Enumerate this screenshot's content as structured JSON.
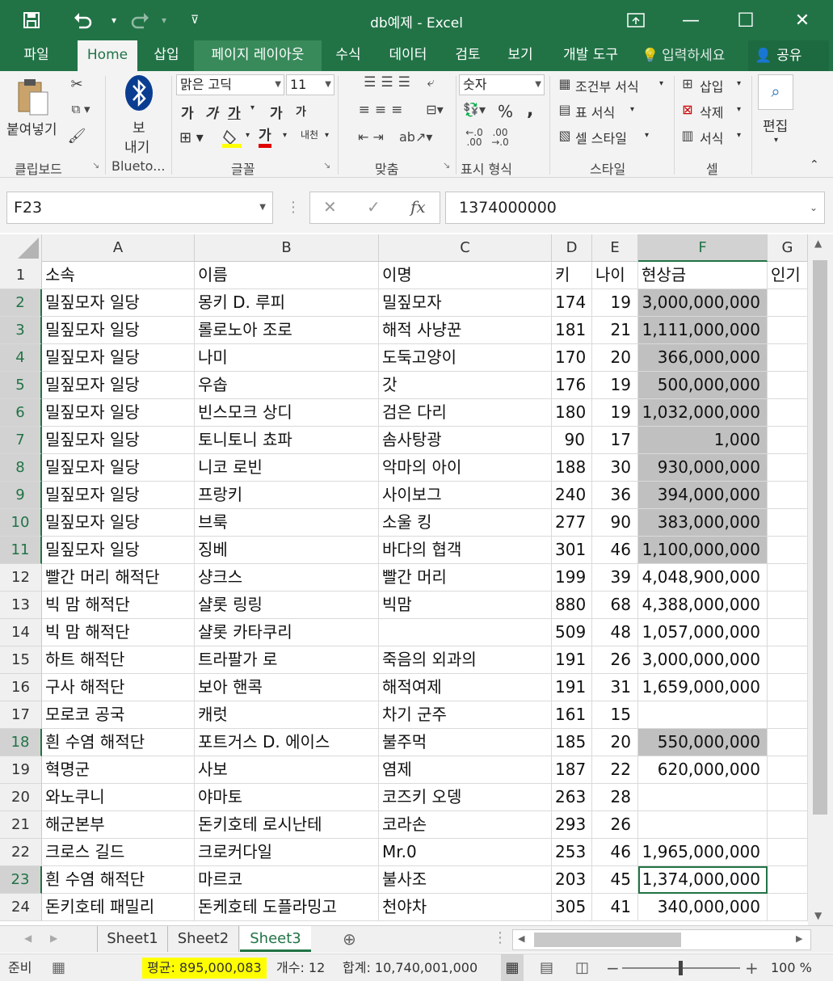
{
  "app": {
    "doc_title": "db예제 - Excel"
  },
  "titlebar": {
    "save_icon": "save-icon",
    "undo_icon": "undo-icon",
    "redo_icon": "redo-icon",
    "customize_icon": "customize-icon",
    "restore_icon": "restore-ribbon-icon",
    "minimize": "—",
    "maximize": "☐",
    "close": "✕"
  },
  "tabs": [
    "파일",
    "Home",
    "삽입",
    "페이지 레이아웃",
    "수식",
    "데이터",
    "검토",
    "보기",
    "개발 도구"
  ],
  "tell_me": "입력하세요",
  "share": "공유",
  "ribbon": {
    "clipboard": {
      "paste": "붙여넣기",
      "label": "클립보드"
    },
    "bluetooth": {
      "send": "보",
      "send2": "내기",
      "label": "Blueto..."
    },
    "font": {
      "name": "맑은 고딕",
      "size": "11",
      "bold": "가",
      "italic": "가",
      "underline": "가",
      "grow": "가",
      "shrink": "가",
      "color_a": "가",
      "phonetic": "내천",
      "label": "글꼴"
    },
    "align": {
      "label": "맞춤"
    },
    "number": {
      "format": "숫자",
      "percent": "%",
      "comma": ",",
      "label": "표시 형식"
    },
    "styles": {
      "conditional": "조건부 서식",
      "table": "표 서식",
      "cell": "셀 스타일",
      "label": "스타일"
    },
    "cells": {
      "insert": "삽입",
      "delete": "삭제",
      "format": "서식",
      "label": "셀"
    },
    "editing": {
      "label": "편집"
    }
  },
  "formula": {
    "namebox": "F23",
    "cancel": "✕",
    "enter": "✓",
    "fx": "fx",
    "value": "1374000000"
  },
  "columns": [
    "A",
    "B",
    "C",
    "D",
    "E",
    "F"
  ],
  "rows": [
    {
      "n": "1",
      "a": "소속",
      "b": "이름",
      "c": "이명",
      "d": "키",
      "e": "나이",
      "f": "현상금",
      "g": "인기"
    },
    {
      "n": "2",
      "a": "밀짚모자 일당",
      "b": "몽키 D. 루피",
      "c": "밀짚모자",
      "d": "174",
      "e": "19",
      "f": "3,000,000,000"
    },
    {
      "n": "3",
      "a": "밀짚모자 일당",
      "b": "롤로노아 조로",
      "c": "해적 사냥꾼",
      "d": "181",
      "e": "21",
      "f": "1,111,000,000"
    },
    {
      "n": "4",
      "a": "밀짚모자 일당",
      "b": "나미",
      "c": "도둑고양이",
      "d": "170",
      "e": "20",
      "f": "366,000,000"
    },
    {
      "n": "5",
      "a": "밀짚모자 일당",
      "b": "우솝",
      "c": "갓",
      "d": "176",
      "e": "19",
      "f": "500,000,000"
    },
    {
      "n": "6",
      "a": "밀짚모자 일당",
      "b": "빈스모크 상디",
      "c": "검은 다리",
      "d": "180",
      "e": "19",
      "f": "1,032,000,000"
    },
    {
      "n": "7",
      "a": "밀짚모자 일당",
      "b": "토니토니 쵸파",
      "c": "솜사탕광",
      "d": "90",
      "e": "17",
      "f": "1,000"
    },
    {
      "n": "8",
      "a": "밀짚모자 일당",
      "b": "니코 로빈",
      "c": "악마의 아이",
      "d": "188",
      "e": "30",
      "f": "930,000,000"
    },
    {
      "n": "9",
      "a": "밀짚모자 일당",
      "b": "프랑키",
      "c": "사이보그",
      "d": "240",
      "e": "36",
      "f": "394,000,000"
    },
    {
      "n": "10",
      "a": "밀짚모자 일당",
      "b": "브룩",
      "c": "소울 킹",
      "d": "277",
      "e": "90",
      "f": "383,000,000"
    },
    {
      "n": "11",
      "a": "밀짚모자 일당",
      "b": "징베",
      "c": "바다의 협객",
      "d": "301",
      "e": "46",
      "f": "1,100,000,000"
    },
    {
      "n": "12",
      "a": "빨간 머리 해적단",
      "b": "샹크스",
      "c": "빨간 머리",
      "d": "199",
      "e": "39",
      "f": "4,048,900,000"
    },
    {
      "n": "13",
      "a": "빅 맘 해적단",
      "b": "샬롯 링링",
      "c": "빅맘",
      "d": "880",
      "e": "68",
      "f": "4,388,000,000"
    },
    {
      "n": "14",
      "a": "빅 맘 해적단",
      "b": "샬롯 카타쿠리",
      "c": "",
      "d": "509",
      "e": "48",
      "f": "1,057,000,000"
    },
    {
      "n": "15",
      "a": "하트 해적단",
      "b": "트라팔가 로",
      "c": "죽음의 외과의",
      "d": "191",
      "e": "26",
      "f": "3,000,000,000"
    },
    {
      "n": "16",
      "a": "구사 해적단",
      "b": "보아 핸콕",
      "c": "해적여제",
      "d": "191",
      "e": "31",
      "f": "1,659,000,000"
    },
    {
      "n": "17",
      "a": "모로코 공국",
      "b": "캐럿",
      "c": "차기 군주",
      "d": "161",
      "e": "15",
      "f": ""
    },
    {
      "n": "18",
      "a": "흰 수염 해적단",
      "b": "포트거스 D. 에이스",
      "c": "불주먹",
      "d": "185",
      "e": "20",
      "f": "550,000,000"
    },
    {
      "n": "19",
      "a": "혁명군",
      "b": "사보",
      "c": "염제",
      "d": "187",
      "e": "22",
      "f": "620,000,000"
    },
    {
      "n": "20",
      "a": "와노쿠니",
      "b": "야마토",
      "c": "코즈키 오뎅",
      "d": "263",
      "e": "28",
      "f": ""
    },
    {
      "n": "21",
      "a": "해군본부",
      "b": "돈키호테 로시난테",
      "c": "코라손",
      "d": "293",
      "e": "26",
      "f": ""
    },
    {
      "n": "22",
      "a": "크로스 길드",
      "b": "크로커다일",
      "c": "Mr.0",
      "d": "253",
      "e": "46",
      "f": "1,965,000,000"
    },
    {
      "n": "23",
      "a": "흰 수염 해적단",
      "b": "마르코",
      "c": "불사조",
      "d": "203",
      "e": "45",
      "f": "1,374,000,000"
    },
    {
      "n": "24",
      "a": "돈키호테 패밀리",
      "b": "돈케호테 도플라밍고",
      "c": "천야차",
      "d": "305",
      "e": "41",
      "f": "340,000,000"
    }
  ],
  "sheets": [
    "Sheet1",
    "Sheet2",
    "Sheet3"
  ],
  "status": {
    "ready": "준비",
    "average": "평균: 895,000,083",
    "count": "개수: 12",
    "sum": "합계: 10,740,001,000",
    "zoom": "100 %",
    "highlight_color": "#ffff00"
  },
  "colors": {
    "accent": "#217346",
    "selection_shade": "#c0c0c0"
  }
}
